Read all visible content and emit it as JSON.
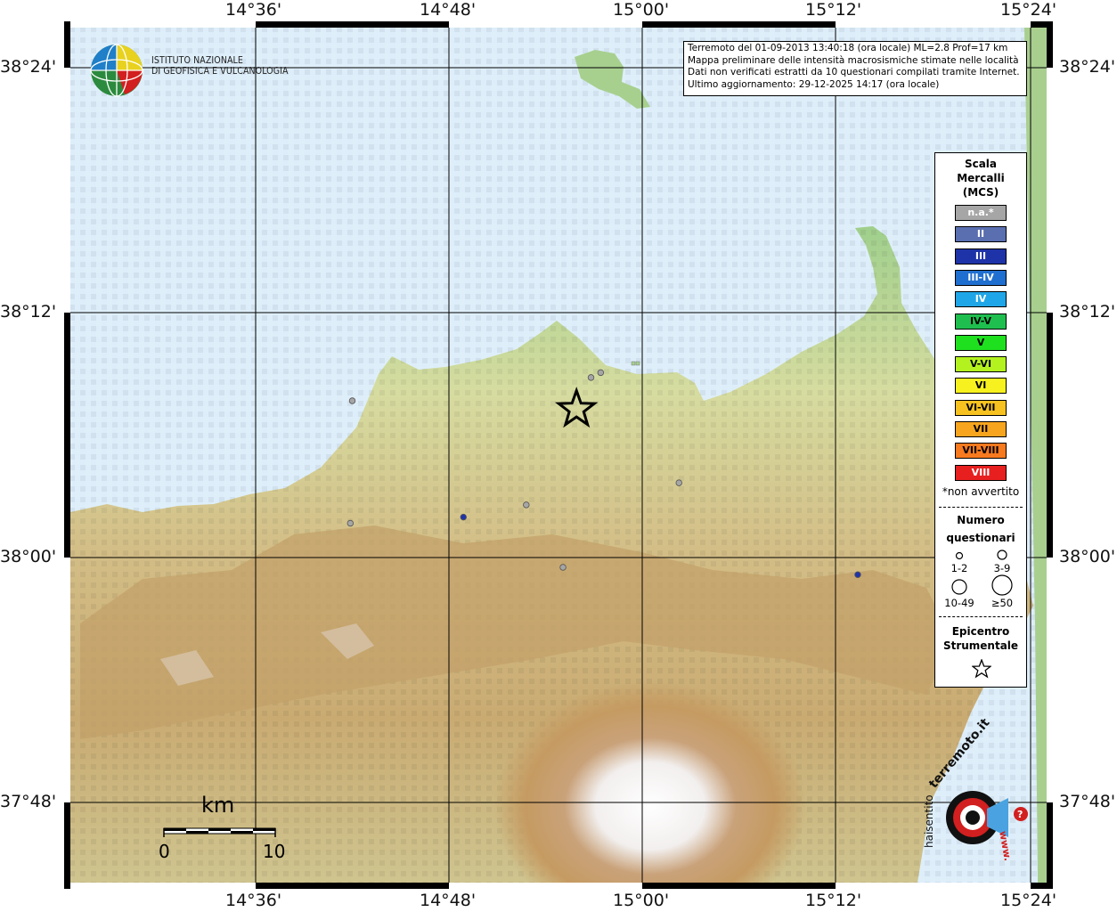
{
  "info": {
    "line1": "Terremoto del 01-09-2013 13:40:18 (ora locale) ML=2.8 Prof=17 km",
    "line2": "Mappa preliminare delle intensità macrosismiche stimate nelle località",
    "line3": "Dati non verificati estratti da 10 questionari compilati tramite Internet.",
    "line4": "Ultimo aggiornamento: 29-12-2025 14:17 (ora locale)"
  },
  "logo": {
    "line1": "ISTITUTO NAZIONALE",
    "line2": "DI GEOFISICA E VULCANOLOGIA"
  },
  "axes": {
    "lon_labels": [
      "14°36'",
      "14°48'",
      "15°00'",
      "15°12'",
      "15°24'"
    ],
    "lat_labels": [
      "38°24'",
      "38°12'",
      "38°00'",
      "37°48'"
    ]
  },
  "legend": {
    "title": [
      "Scala",
      "Mercalli",
      "(MCS)"
    ],
    "scale": [
      {
        "label": "n.a.*",
        "color": "#a6a6a6",
        "text_color": "#ffffff"
      },
      {
        "label": "II",
        "color": "#5a6fb0",
        "text_color": "#ffffff"
      },
      {
        "label": "III",
        "color": "#1f33a8",
        "text_color": "#ffffff"
      },
      {
        "label": "III-IV",
        "color": "#1f6fd0",
        "text_color": "#ffffff"
      },
      {
        "label": "IV",
        "color": "#1fa6e8",
        "text_color": "#ffffff"
      },
      {
        "label": "IV-V",
        "color": "#1fbf4f",
        "text_color": "#000000"
      },
      {
        "label": "V",
        "color": "#1fe01f",
        "text_color": "#000000"
      },
      {
        "label": "V-VI",
        "color": "#b3f21f",
        "text_color": "#000000"
      },
      {
        "label": "VI",
        "color": "#f7f21f",
        "text_color": "#000000"
      },
      {
        "label": "VI-VII",
        "color": "#f7c21f",
        "text_color": "#000000"
      },
      {
        "label": "VII",
        "color": "#f7a51f",
        "text_color": "#000000"
      },
      {
        "label": "VII-VIII",
        "color": "#f77a1f",
        "text_color": "#000000"
      },
      {
        "label": "VIII",
        "color": "#e81f1f",
        "text_color": "#ffffff"
      }
    ],
    "non_avvertito": "*non avvertito",
    "numero_title": [
      "Numero",
      "questionari"
    ],
    "numero_classes": [
      "1-2",
      "3-9",
      "10-49",
      "≥50"
    ],
    "epicentro_title": [
      "Epicentro",
      "Strumentale"
    ]
  },
  "scalebar": {
    "unit": "km",
    "start": "0",
    "end": "10"
  },
  "points": [
    {
      "lon": 14.7,
      "lat": 38.128,
      "intensity": "n.a.*",
      "color": "#a6a6a6"
    },
    {
      "lon": 14.698,
      "lat": 38.028,
      "intensity": "n.a.*",
      "color": "#a6a6a6"
    },
    {
      "lon": 14.815,
      "lat": 38.033,
      "intensity": "III",
      "color": "#1f33a8"
    },
    {
      "lon": 14.88,
      "lat": 38.043,
      "intensity": "n.a.*",
      "color": "#a6a6a6"
    },
    {
      "lon": 14.918,
      "lat": 37.992,
      "intensity": "n.a.*",
      "color": "#a6a6a6"
    },
    {
      "lon": 14.947,
      "lat": 38.147,
      "intensity": "n.a.*",
      "color": "#a6a6a6"
    },
    {
      "lon": 14.957,
      "lat": 38.151,
      "intensity": "n.a.*",
      "color": "#a6a6a6"
    },
    {
      "lon": 15.038,
      "lat": 38.061,
      "intensity": "n.a.*",
      "color": "#a6a6a6"
    },
    {
      "lon": 15.223,
      "lat": 37.986,
      "intensity": "III",
      "color": "#1f33a8"
    }
  ],
  "epicenter": {
    "lon": 14.932,
    "lat": 38.121
  },
  "badge": {
    "text_top": "terremoto.it",
    "text_left": "haisentito",
    "text_bottom": "www."
  }
}
